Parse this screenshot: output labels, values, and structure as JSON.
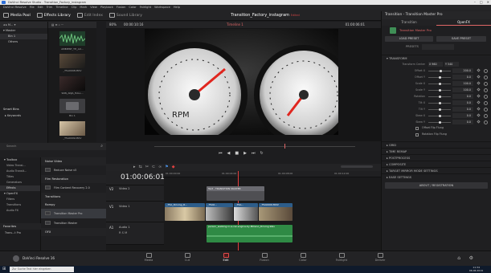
{
  "window": {
    "title": "DaVinci Resolve Studio - Transition_Factory_instagram",
    "menu": [
      "DaVinci Resolve",
      "File",
      "Edit",
      "Trim",
      "Timeline",
      "Clip",
      "Mark",
      "View",
      "Playback",
      "Fusion",
      "Color",
      "Fairlight",
      "Workspace",
      "Help"
    ]
  },
  "toolbar": {
    "media_pool": "Media Pool",
    "effects_library": "Effects Library",
    "edit_index": "Edit Index",
    "sound_library": "Sound Library",
    "project_title": "Transition_Factory_instagram",
    "edited": "Edited",
    "mixer": "Mixer",
    "metadata": "Metadata",
    "inspector": "Inspector"
  },
  "media_pool": {
    "header": "Master",
    "items": [
      {
        "label": "Bin 1"
      },
      {
        "label": "Others"
      }
    ],
    "smart_bins": "Smart Bins",
    "keywords": "Keywords",
    "clips": [
      {
        "label": "AMBIENT_TH_AU..."
      },
      {
        "label": "_T5A0048.MOV"
      },
      {
        "label": "SNN_ANJA_HALL..."
      },
      {
        "label": "Bin 1"
      },
      {
        "label": "_T5A0009.MOV"
      }
    ]
  },
  "viewer": {
    "zoom": "80%",
    "source_tc": "00:00:10:16",
    "timeline_name": "Timeline 1",
    "record_tc": "01:00:06:01"
  },
  "effects": {
    "search_placeholder": "Search",
    "tree": [
      {
        "label": "Toolbox",
        "sel": false
      },
      {
        "label": "Video Transi...",
        "sel": false
      },
      {
        "label": "Audio Transit...",
        "sel": false
      },
      {
        "label": "Titles",
        "sel": false
      },
      {
        "label": "Generators",
        "sel": false
      },
      {
        "label": "Effects",
        "sel": true
      },
      {
        "label": "OpenFX",
        "sel": false
      },
      {
        "label": "Filters",
        "sel": false
      },
      {
        "label": "Transitions",
        "sel": false
      },
      {
        "label": "Audio FX",
        "sel": false
      }
    ],
    "favorites": "Favorites",
    "favorite_item": "Trans...t Pro",
    "groups": [
      {
        "name": "Noise Video",
        "items": [
          "Reduce Noise v5"
        ]
      },
      {
        "name": "Film Restoration",
        "items": [
          "Film Content Recovery 2.0"
        ]
      },
      {
        "name": "Transitions",
        "items": []
      },
      {
        "name": "Rampy",
        "items": [
          "Transition Master Pro",
          "Transition Master"
        ]
      },
      {
        "name": "OFX",
        "items": []
      }
    ]
  },
  "inspector": {
    "title": "Transition - Transition Master Pro",
    "tabs": [
      "Transition",
      "OpenFX"
    ],
    "effect_name": "Transition Master Pro",
    "load_preset": "LOAD PRESET",
    "save_preset": "SAVE PRESET",
    "presets_label": "PRESETS",
    "transform_section": "TRANSFORM",
    "transform_center_label": "Transform Center",
    "transform_center_x": "X 960",
    "transform_center_y": "Y 540",
    "params": [
      {
        "label": "Offset X",
        "value": "200.0",
        "knob": 0.55
      },
      {
        "label": "Offset Y",
        "value": "0.0",
        "knob": 0.5
      },
      {
        "label": "Scale X",
        "value": "100.0",
        "knob": 0.5
      },
      {
        "label": "Scale Y",
        "value": "100.0",
        "knob": 0.5
      },
      {
        "label": "Rotation",
        "value": "0.0",
        "knob": 0.5
      },
      {
        "label": "Tilt X",
        "value": "0.0",
        "knob": 0.5
      },
      {
        "label": "Tilt Y",
        "value": "0.0",
        "knob": 0.5
      },
      {
        "label": "Skew X",
        "value": "0.0",
        "knob": 0.5
      },
      {
        "label": "Skew Y",
        "value": "0.0",
        "knob": 0.5
      }
    ],
    "flip_h": "Offset Flip Flung",
    "flip_r": "Rotation Flip Flung",
    "sections": [
      "GRID",
      "TIME REMAP",
      "POSTPROCESS",
      "COMPOSITE",
      "TARGET MIRROR MODE SETTINGS",
      "EASE SETTINGS"
    ],
    "about": "ABOUT / REGISTRATION"
  },
  "timeline": {
    "timecode": "01:00:06:01",
    "ruler": [
      "01:00:00:00",
      "01:00:04:00",
      "01:00:08:00",
      "01:00:12:00"
    ],
    "tracks": [
      {
        "id": "V2",
        "name": "Video 2"
      },
      {
        "id": "V1",
        "name": "Video 1"
      },
      {
        "id": "A1",
        "name": "Audio 1"
      }
    ],
    "title_clip": "Text - TRANSITION MASTER",
    "v1_clips": [
      "_T5A_Driving_R...",
      "_T5A0...",
      "_T5A...",
      "_T5A0009.MOV"
    ],
    "audio_clip": "person_walking-in-a-car-engine-by-Miliano_Driving.Wav"
  },
  "pages": [
    "Media",
    "Cut",
    "Edit",
    "Fusion",
    "Color",
    "Fairlight",
    "Deliver"
  ],
  "active_page": "Edit",
  "app_name": "DaVinci Resolve 16",
  "taskbar_search": "Zur Suche Text hier eingeben",
  "clock_time": "11:34",
  "clock_date": "06.06.2019"
}
